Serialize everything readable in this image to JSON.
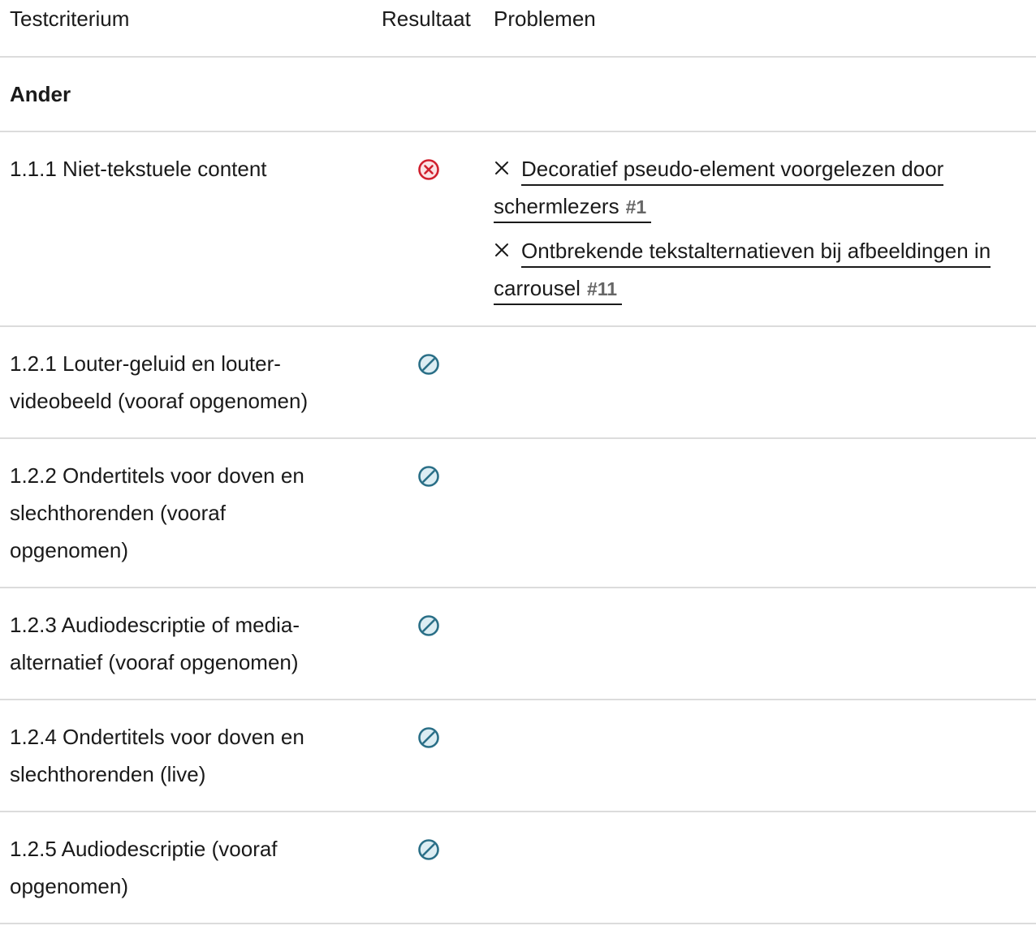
{
  "header": {
    "criterion": "Testcriterium",
    "result": "Resultaat",
    "problems": "Problemen"
  },
  "section": {
    "title": "Ander"
  },
  "rows": [
    {
      "criterion": "1.1.1 Niet-tekstuele content",
      "result": "failed",
      "result_icon": "circle-x-icon",
      "problems": [
        {
          "text": "Decoratief pseudo-element voorgelezen door schermlezers",
          "number": "#1"
        },
        {
          "text": "Ontbrekende tekstalternatieven bij afbeeldingen in carrousel",
          "number": "#11"
        }
      ]
    },
    {
      "criterion": "1.2.1 Louter-geluid en louter-videobeeld (vooraf opgenomen)",
      "result": "not-applicable",
      "result_icon": "circle-slash-icon",
      "problems": []
    },
    {
      "criterion": "1.2.2 Ondertitels voor doven en slechthorenden (vooraf opgenomen)",
      "result": "not-applicable",
      "result_icon": "circle-slash-icon",
      "problems": []
    },
    {
      "criterion": "1.2.3 Audiodescriptie of media-alternatief (vooraf opgenomen)",
      "result": "not-applicable",
      "result_icon": "circle-slash-icon",
      "problems": []
    },
    {
      "criterion": "1.2.4 Ondertitels voor doven en slechthorenden (live)",
      "result": "not-applicable",
      "result_icon": "circle-slash-icon",
      "problems": []
    },
    {
      "criterion": "1.2.5 Audiodescriptie (vooraf opgenomen)",
      "result": "not-applicable",
      "result_icon": "circle-slash-icon",
      "problems": []
    }
  ],
  "colors": {
    "failed": "#d0202e",
    "failed_fill": "#fbe3e5",
    "not_applicable": "#2a6f87",
    "not_applicable_fill": "#dcedf3",
    "divider": "#dcdcdc",
    "text": "#1a1a1a",
    "muted": "#666666"
  }
}
